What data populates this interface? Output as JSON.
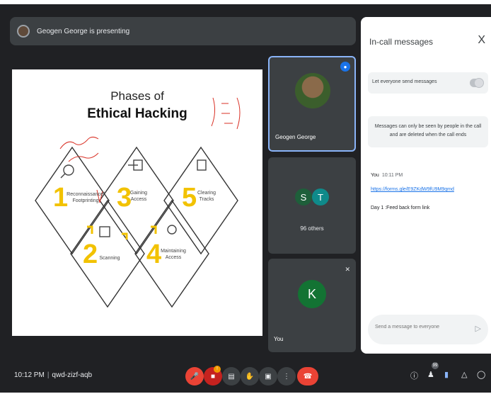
{
  "banner": {
    "text": "Geogen George is presenting"
  },
  "slide": {
    "title_line1": "Phases of",
    "title_line2": "Ethical Hacking",
    "phases": [
      {
        "num": "1",
        "label": "Reconnaissance/\nFootprinting"
      },
      {
        "num": "2",
        "label": "Scanning"
      },
      {
        "num": "3",
        "label": "Gaining\nAccess"
      },
      {
        "num": "4",
        "label": "Maintaining\nAccess"
      },
      {
        "num": "5",
        "label": "Clearing\nTracks"
      }
    ]
  },
  "tiles": {
    "presenter_name": "Geogen George",
    "avatar_s": "S",
    "avatar_t": "T",
    "others": "96 others",
    "self_initial": "K",
    "self_name": "You"
  },
  "chat": {
    "title": "In-call messages",
    "close": "X",
    "toggle_label": "Let everyone send messages",
    "info": "Messages can only be seen by people in the call and are deleted when the call ends",
    "msg_sender": "You",
    "msg_time": "10:11 PM",
    "msg_link": "https://forms.gle/E9ZKdW9fU9M9qmd",
    "msg_text": "Day 1 :Feed back form link",
    "input_placeholder": "Send a message to everyone"
  },
  "bottom": {
    "time": "10:12 PM",
    "separator": "|",
    "meeting_code": "qwd-zizf-aqb",
    "participants_badge": "99"
  },
  "colors": {
    "accent_yellow": "#f2c200",
    "hangup_red": "#ea4335",
    "active_blue": "#8ab4f8"
  },
  "icons": [
    "mic-off-icon",
    "camera-off-icon",
    "captions-icon",
    "raise-hand-icon",
    "present-icon",
    "more-icon",
    "hangup-icon",
    "info-icon",
    "people-icon",
    "chat-icon",
    "activities-icon",
    "lock-icon"
  ]
}
